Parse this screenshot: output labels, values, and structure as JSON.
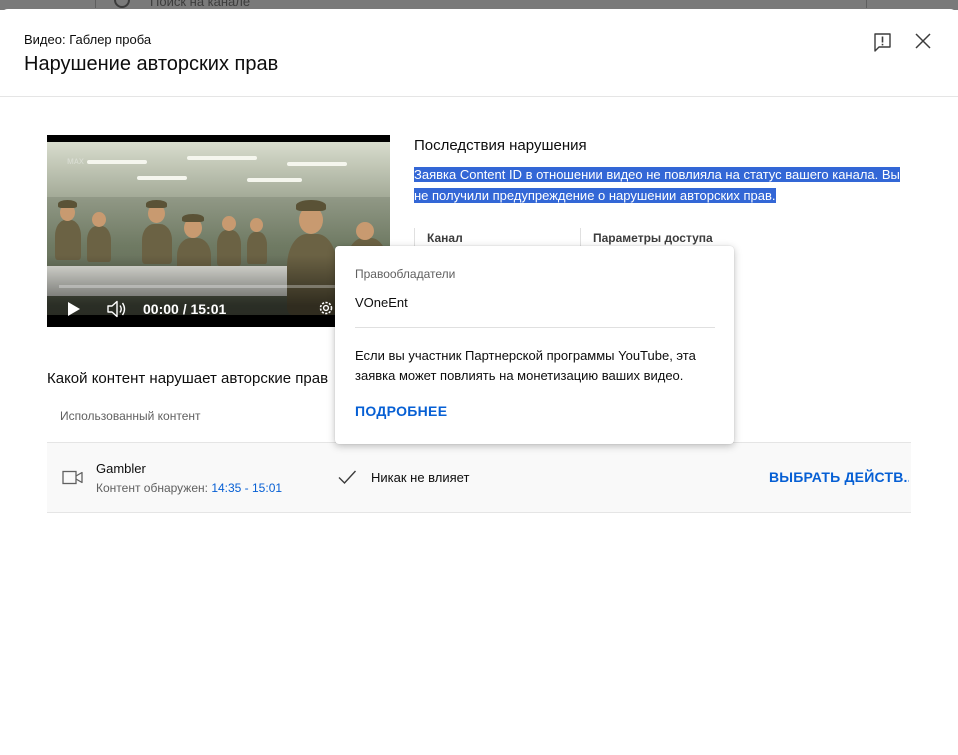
{
  "background": {
    "search_placeholder": "Поиск на канале"
  },
  "dialog": {
    "video_label": "Видео: Габлер проба",
    "title": "Нарушение авторских прав"
  },
  "player": {
    "time": "00:00 / 15:01",
    "progress": 0
  },
  "consequences": {
    "title": "Последствия нарушения",
    "text_line1": "Заявка Content ID в отношении видео не повлияла на статус вашего канала. Вы",
    "text_line2": "не получили предупреждение о нарушении авторских прав.",
    "col_channel": "Канал",
    "col_access": "Параметры доступа"
  },
  "content_section": {
    "title": "Какой контент нарушает авторские прав",
    "column_used": "Использованный контент",
    "rows": [
      {
        "title": "Gambler",
        "detected_label": "Контент обнаружен: ",
        "detected_time": "14:35 - 15:01",
        "impact": "Никак не влияет",
        "action": "ВЫБРАТЬ ДЕЙСТВ..."
      }
    ]
  },
  "popup": {
    "label": "Правообладатели",
    "owner": "VOneEnt",
    "note": "Если вы участник Партнерской программы YouTube, эта заявка может повлиять на монетизацию ваших видео.",
    "link": "ПОДРОБНЕЕ"
  },
  "colors": {
    "accent": "#065fd4",
    "selection": "#3367d6"
  }
}
